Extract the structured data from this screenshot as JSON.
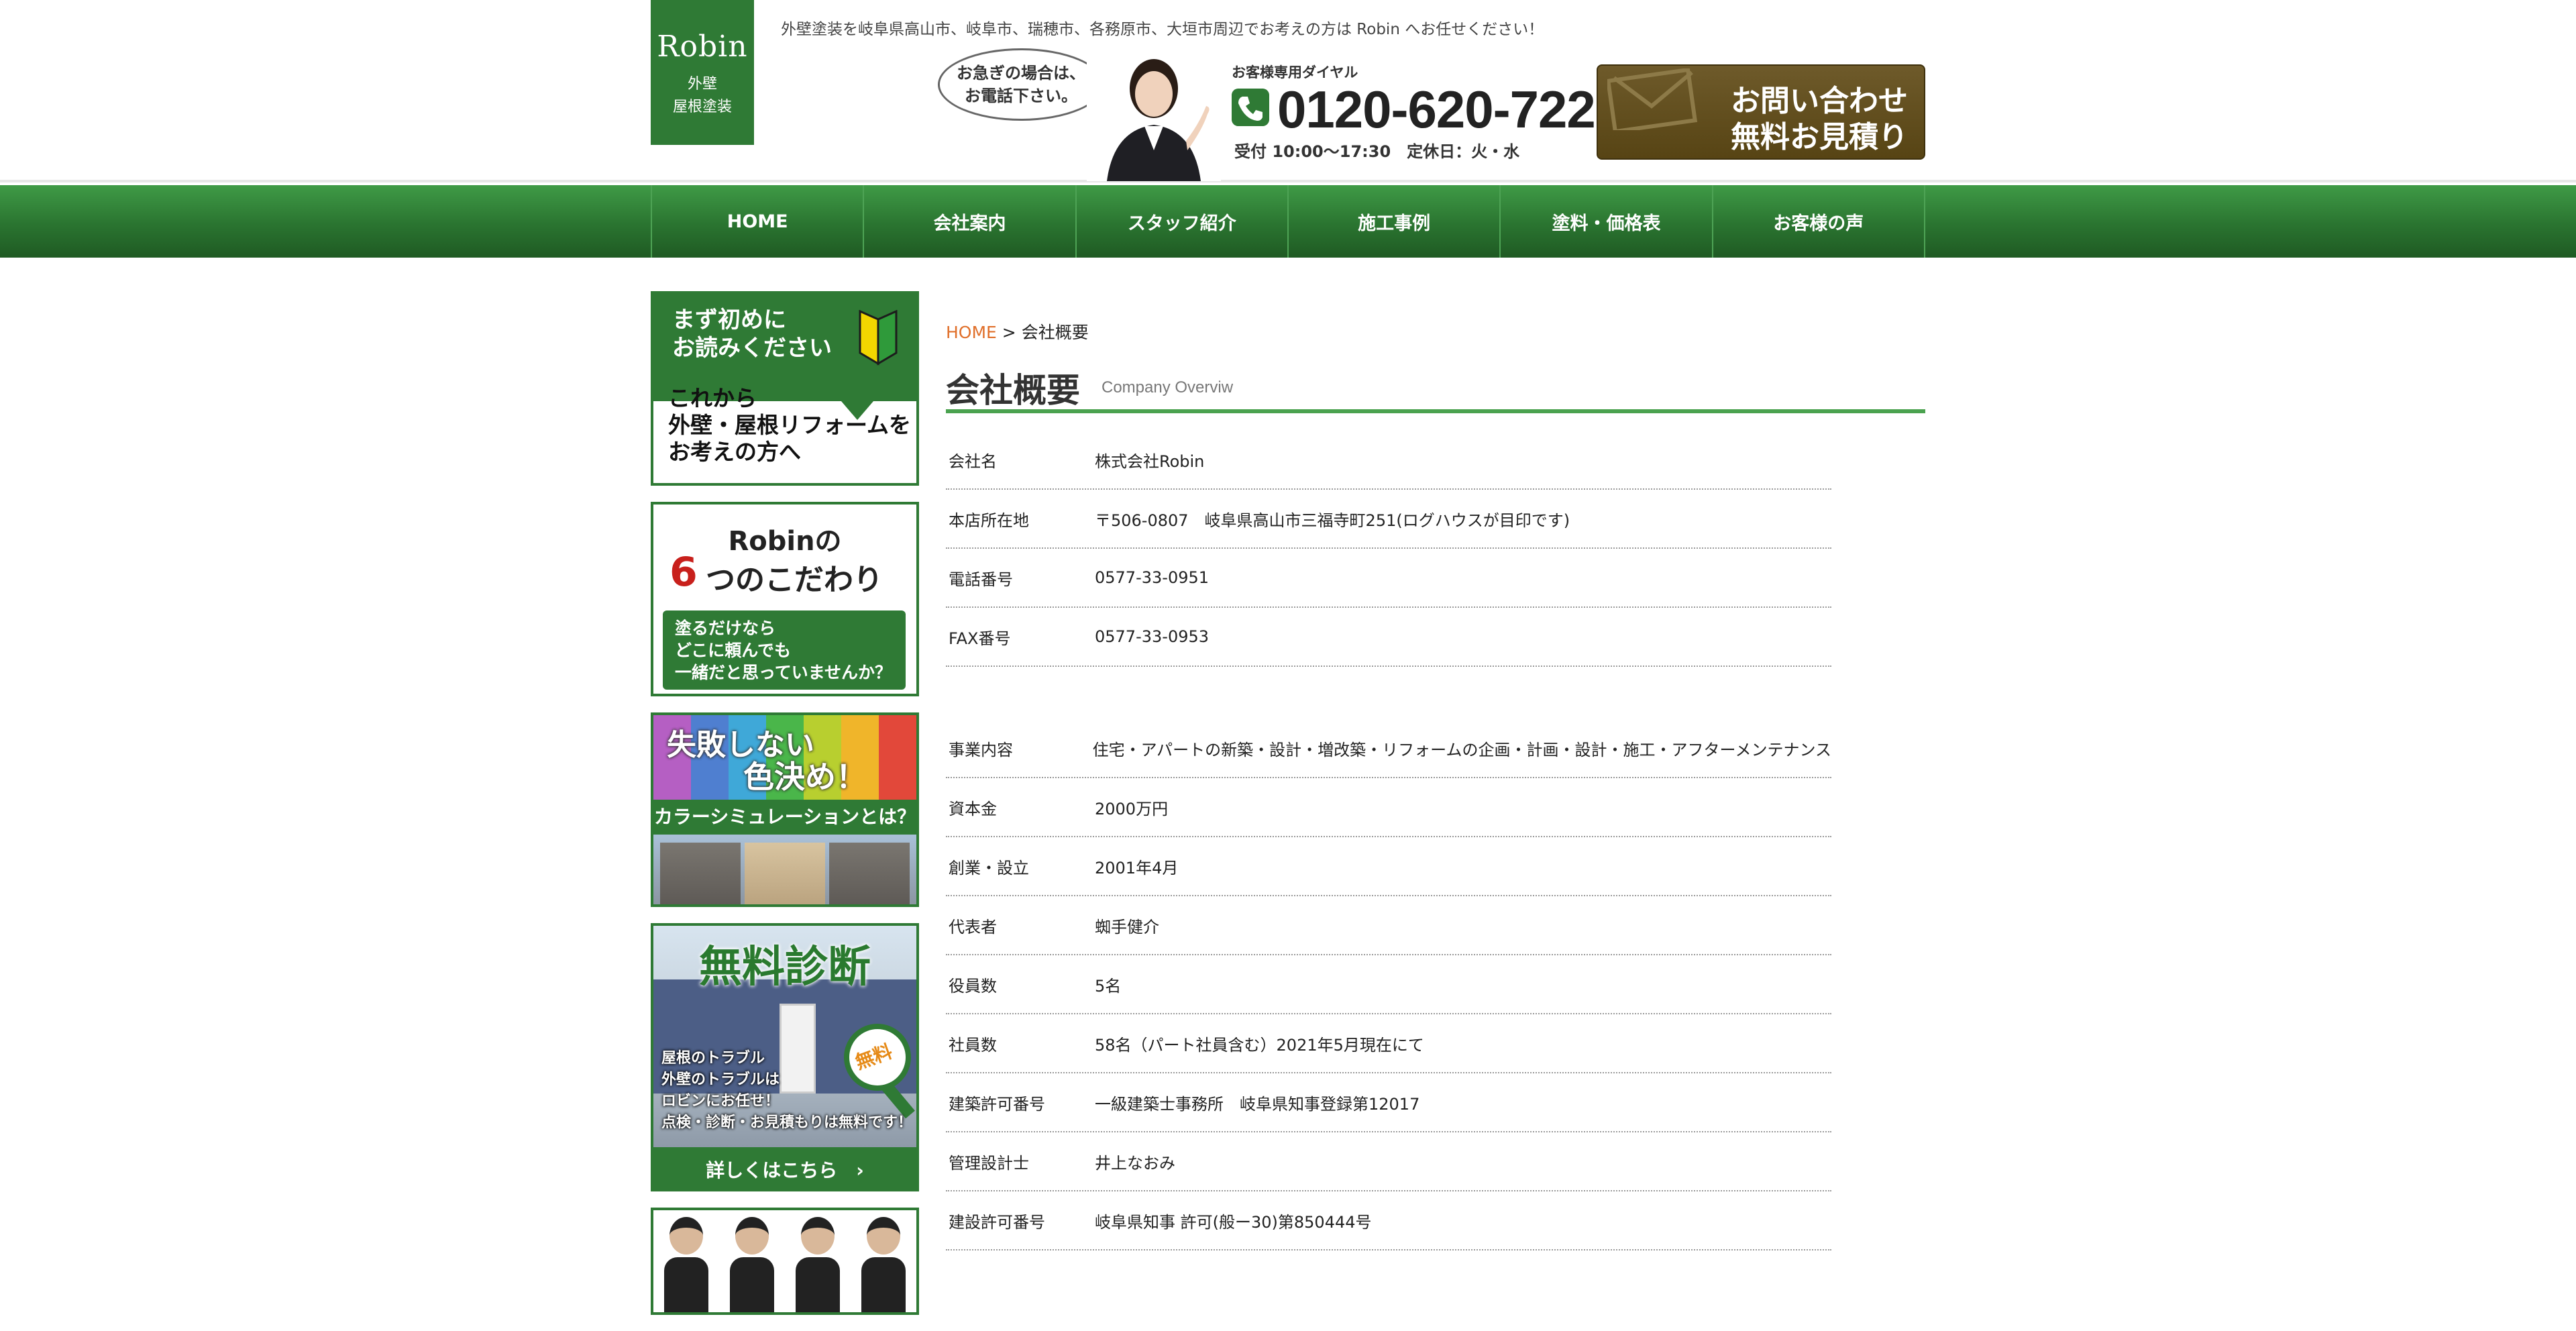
{
  "header": {
    "logo_brand": "Robin",
    "logo_sub_1": "外壁",
    "logo_sub_2": "屋根塗装",
    "tagline": "外壁塗装を岐阜県高山市、岐阜市、瑞穂市、各務原市、大垣市周辺でお考えの方は Robin へお任せください！",
    "bubble_line1": "お急ぎの場合は、",
    "bubble_line2": "お電話下さい。",
    "dial_label": "お客様専用ダイヤル",
    "phone_number": "0120-620-722",
    "hours": "受付 10:00〜17:30　定休日：火・水",
    "contact_line1": "お問い合わせ",
    "contact_line2": "無料お見積り"
  },
  "nav": {
    "items": [
      "HOME",
      "会社案内",
      "スタッフ紹介",
      "施工事例",
      "塗料・価格表",
      "お客様の声"
    ]
  },
  "sidebar": {
    "banner1": {
      "line1": "まず初めに",
      "line2": "お読みください",
      "line3": "これから",
      "line4": "外壁・屋根リフォームを",
      "line5": "お考えの方へ"
    },
    "banner2": {
      "robin": "Robinの",
      "six": "6",
      "kodawari": "つのこだわり",
      "line1": "塗るだけなら",
      "line2": "どこに頼んでも",
      "line3": "一緒だと思っていませんか？"
    },
    "banner3": {
      "line1": "失敗しない",
      "line2": "色決め！",
      "strip": "カラーシミュレーションとは？"
    },
    "banner4": {
      "title": "無料診断",
      "badge": "無料",
      "line1": "屋根のトラブル",
      "line2": "外壁のトラブルは",
      "line3": "ロビンにお任せ！",
      "line4": "点検・診断・お見積もりは無料です！",
      "detail": "詳しくはこちら　›"
    }
  },
  "main": {
    "breadcrumb_home": "HOME",
    "breadcrumb_sep": " > ",
    "breadcrumb_current": "会社概要",
    "title": "会社概要",
    "subtitle": "Company Overviw",
    "rows_top": [
      {
        "label": "会社名",
        "value": "株式会社Robin"
      },
      {
        "label": "本店所在地",
        "value": "〒506-0807　岐阜県高山市三福寺町251(ログハウスが目印です)"
      },
      {
        "label": "電話番号",
        "value": "0577-33-0951"
      },
      {
        "label": "FAX番号",
        "value": "0577-33-0953"
      }
    ],
    "rows_bottom": [
      {
        "label": "事業内容",
        "value": "住宅・アパートの新築・設計・増改築・リフォームの企画・計画・設計・施工・アフターメンテナンス"
      },
      {
        "label": "資本金",
        "value": "2000万円"
      },
      {
        "label": "創業・設立",
        "value": "2001年4月"
      },
      {
        "label": "代表者",
        "value": "蜘手健介"
      },
      {
        "label": "役員数",
        "value": "5名"
      },
      {
        "label": "社員数",
        "value": "58名（パート社員含む）2021年5月現在にて"
      },
      {
        "label": "建築許可番号",
        "value": "一級建築士事務所　岐阜県知事登録第12017"
      },
      {
        "label": "管理設計士",
        "value": "井上なおみ"
      },
      {
        "label": "建設許可番号",
        "value": "岐阜県知事 許可(般ー30)第850444号"
      }
    ]
  },
  "colors": {
    "brand_green": "#2f7a35",
    "accent_orange": "#e06f2a",
    "contact_brown": "#6e5a2a"
  }
}
